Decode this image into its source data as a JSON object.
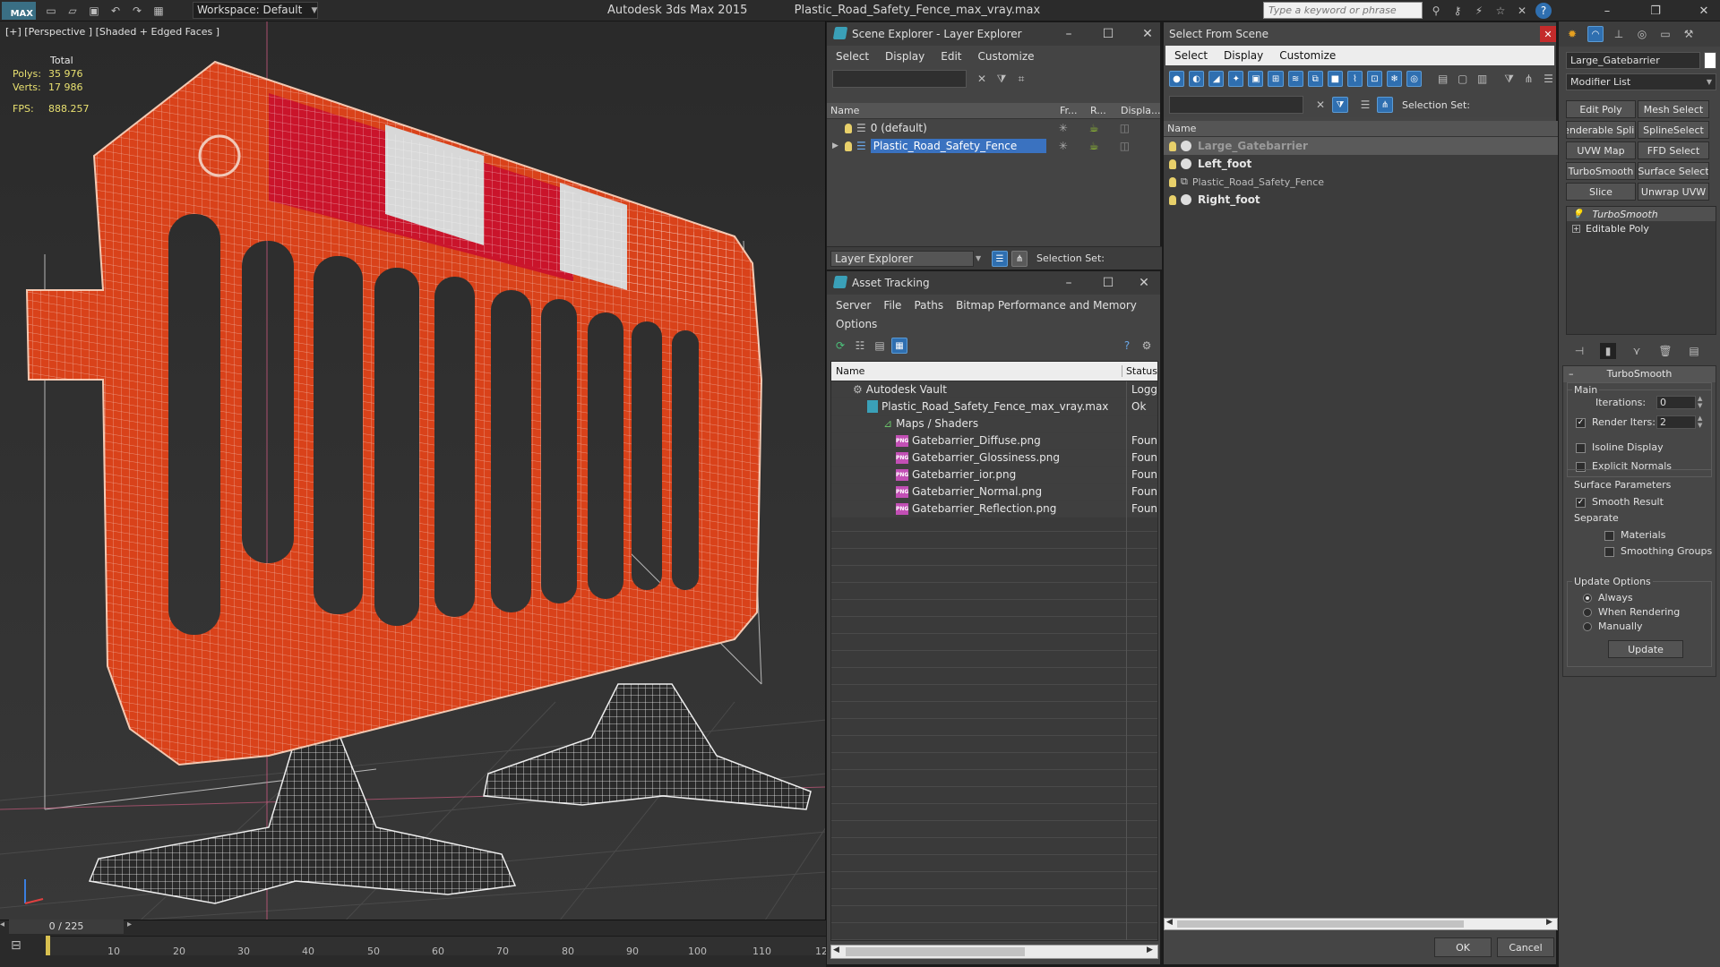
{
  "titlebar": {
    "workspace": "Workspace: Default",
    "app_name": "Autodesk 3ds Max  2015",
    "file_name": "Plastic_Road_Safety_Fence_max_vray.max",
    "search_placeholder": "Type a keyword or phrase",
    "logo": "MAX"
  },
  "viewport": {
    "label": "[+] [Perspective ] [Shaded + Edged Faces ]",
    "stats": {
      "total_label": "Total",
      "polys_label": "Polys:",
      "polys": "35 976",
      "verts_label": "Verts:",
      "verts": "17 986",
      "fps_label": "FPS:",
      "fps": "888.257"
    }
  },
  "timeline": {
    "frame": "0 / 225",
    "ticks": [
      "10",
      "20",
      "30",
      "40",
      "50",
      "60",
      "70",
      "80",
      "90",
      "100",
      "110",
      "12"
    ]
  },
  "scene_explorer": {
    "title": "Scene Explorer - Layer Explorer",
    "menu": [
      "Select",
      "Display",
      "Edit",
      "Customize"
    ],
    "columns": [
      "Name",
      "Fr...",
      "R...",
      "Displa..."
    ],
    "rows": [
      {
        "name": "0 (default)"
      },
      {
        "name": "Plastic_Road_Safety_Fence"
      }
    ],
    "footer_dropdown": "Layer Explorer",
    "selection_set_label": "Selection Set:"
  },
  "asset_tracking": {
    "title": "Asset Tracking",
    "menu": [
      "Server",
      "File",
      "Paths",
      "Bitmap Performance and Memory"
    ],
    "menu2": [
      "Options"
    ],
    "columns": [
      "Name",
      "Status"
    ],
    "rows": [
      {
        "name": "Autodesk Vault",
        "status": "Logge"
      },
      {
        "name": "Plastic_Road_Safety_Fence_max_vray.max",
        "status": "Ok"
      },
      {
        "name": "Maps / Shaders",
        "status": ""
      },
      {
        "name": "Gatebarrier_Diffuse.png",
        "status": "Found"
      },
      {
        "name": "Gatebarrier_Glossiness.png",
        "status": "Found"
      },
      {
        "name": "Gatebarrier_ior.png",
        "status": "Found"
      },
      {
        "name": "Gatebarrier_Normal.png",
        "status": "Found"
      },
      {
        "name": "Gatebarrier_Reflection.png",
        "status": "Found"
      }
    ],
    "png_label": "PNG"
  },
  "select_from_scene": {
    "title": "Select From Scene",
    "menu": [
      "Select",
      "Display",
      "Customize"
    ],
    "selection_set_label": "Selection Set:",
    "column": "Name",
    "rows": [
      {
        "name": "Large_Gatebarrier"
      },
      {
        "name": "Left_foot"
      },
      {
        "name": "Plastic_Road_Safety_Fence"
      },
      {
        "name": "Right_foot"
      }
    ],
    "ok": "OK",
    "cancel": "Cancel"
  },
  "command_panel": {
    "object_name": "Large_Gatebarrier",
    "modifier_list": "Modifier List",
    "buttons": [
      "Edit Poly",
      "Mesh Select",
      "enderable Splir",
      "SplineSelect",
      "UVW Map",
      "FFD Select",
      "TurboSmooth",
      "Surface Select",
      "Slice",
      "Unwrap UVW"
    ],
    "stack": [
      "TurboSmooth",
      "Editable Poly"
    ],
    "rollout_title": "TurboSmooth",
    "main_label": "Main",
    "iterations_label": "Iterations:",
    "iterations": "0",
    "render_iters_label": "Render Iters:",
    "render_iters": "2",
    "isoline": "Isoline Display",
    "explicit_normals": "Explicit Normals",
    "surface_params": "Surface Parameters",
    "smooth_result": "Smooth Result",
    "separate": "Separate",
    "materials": "Materials",
    "smoothing_groups": "Smoothing Groups",
    "update_options": "Update Options",
    "always": "Always",
    "when_rendering": "When Rendering",
    "manually": "Manually",
    "update": "Update"
  }
}
